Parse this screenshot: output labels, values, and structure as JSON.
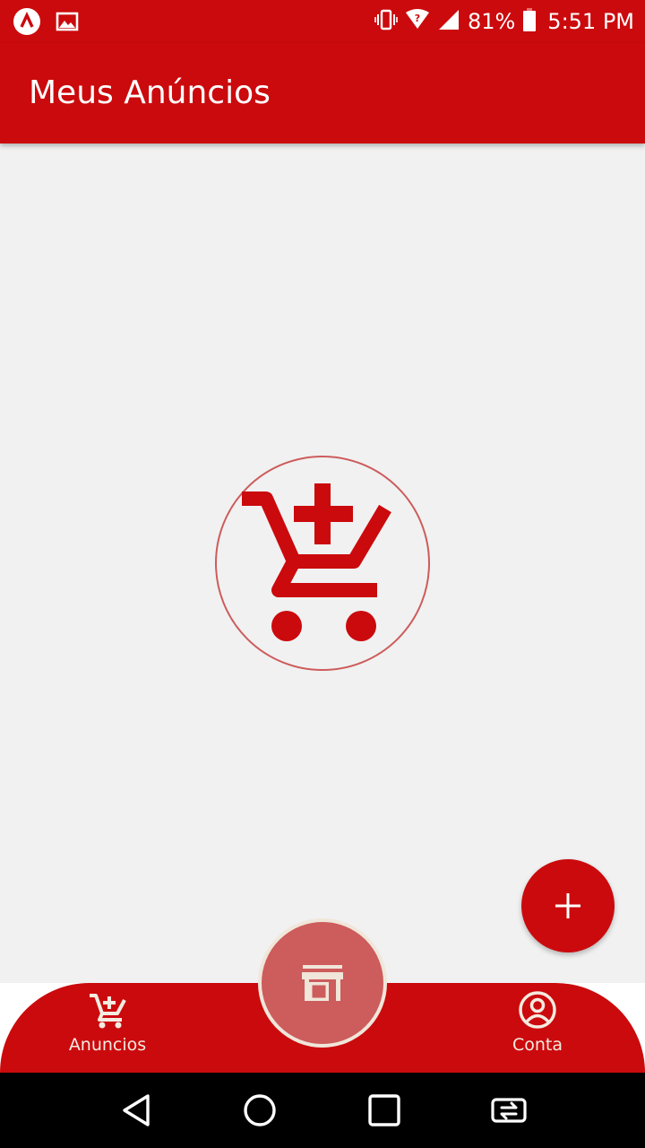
{
  "status_bar": {
    "battery_percent": "81%",
    "time": "5:51 PM",
    "left_icons": [
      "app-notification-icon",
      "image-notification-icon"
    ],
    "right_icons": [
      "vibrate-icon",
      "wifi-icon",
      "signal-icon",
      "battery-icon"
    ]
  },
  "app_bar": {
    "title": "Meus Anúncios"
  },
  "empty_state": {
    "icon": "add-to-cart-icon"
  },
  "fab": {
    "icon": "plus-icon"
  },
  "bottom_nav": {
    "items": [
      {
        "label": "Anuncios",
        "icon": "cart-icon"
      },
      {
        "label": "Conta",
        "icon": "account-circle-icon"
      }
    ],
    "center_icon": "store-icon"
  },
  "system_nav": {
    "buttons": [
      "back-icon",
      "home-icon",
      "recents-icon",
      "switch-app-icon"
    ]
  },
  "colors": {
    "primary": "#cb0a0d",
    "background": "#f1f1f1",
    "center_button": "#cd5c5c",
    "nav_text": "#f3ebe0",
    "empty_circle_stroke": "#cd5c5c"
  }
}
